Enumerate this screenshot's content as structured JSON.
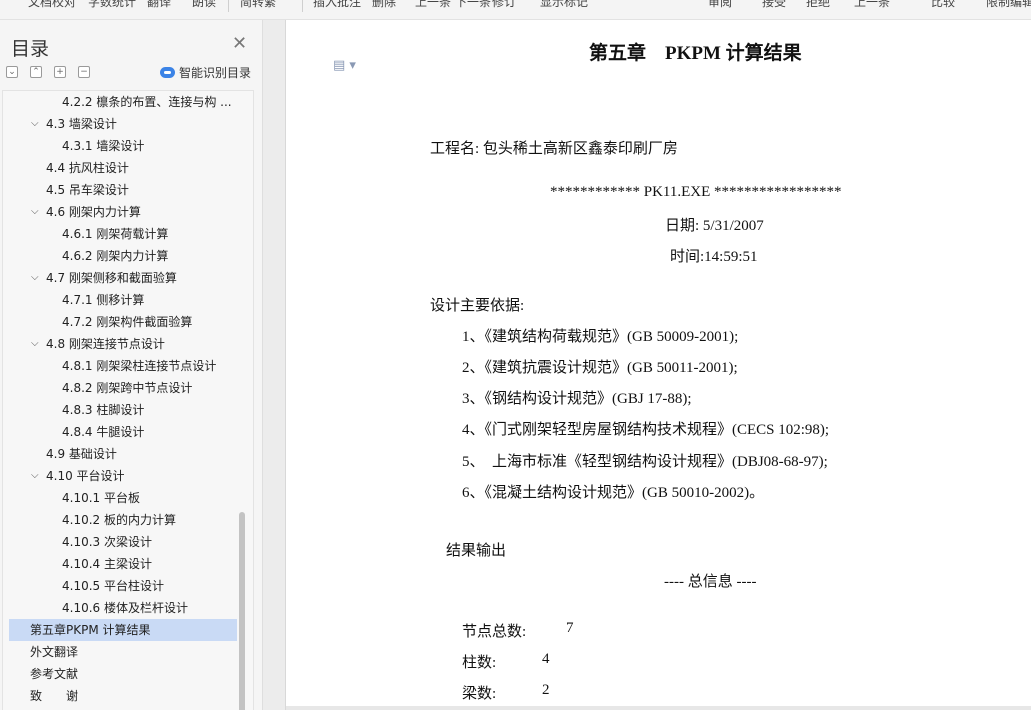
{
  "toolbar": {
    "items": [
      "文档校对",
      "字数统计",
      "翻译",
      "朗读",
      "简转繁",
      "插入批注",
      "删除",
      "上一条",
      "下一条",
      "修订",
      "显示标记",
      "审阅",
      "接受",
      "拒绝",
      "上一条",
      "比较",
      "限制编辑"
    ]
  },
  "sidebar": {
    "title": "目录",
    "smart_toc_label": "智能识别目录",
    "items": [
      {
        "text": "4.2.2 檩条的布置、连接与构 ...",
        "level": 3,
        "expandable": false
      },
      {
        "text": "4.3 墙梁设计",
        "level": 2,
        "expandable": true
      },
      {
        "text": "4.3.1 墙梁设计",
        "level": 3,
        "expandable": false
      },
      {
        "text": "4.4 抗风柱设计",
        "level": 2,
        "expandable": false
      },
      {
        "text": "4.5 吊车梁设计",
        "level": 2,
        "expandable": false
      },
      {
        "text": "4.6 刚架内力计算",
        "level": 2,
        "expandable": true
      },
      {
        "text": "4.6.1 刚架荷载计算",
        "level": 3,
        "expandable": false
      },
      {
        "text": "4.6.2 刚架内力计算",
        "level": 3,
        "expandable": false
      },
      {
        "text": "4.7 刚架侧移和截面验算",
        "level": 2,
        "expandable": true
      },
      {
        "text": "4.7.1 侧移计算",
        "level": 3,
        "expandable": false
      },
      {
        "text": "4.7.2 刚架构件截面验算",
        "level": 3,
        "expandable": false
      },
      {
        "text": "4.8 刚架连接节点设计",
        "level": 2,
        "expandable": true
      },
      {
        "text": "4.8.1 刚架梁柱连接节点设计",
        "level": 3,
        "expandable": false
      },
      {
        "text": "4.8.2 刚架跨中节点设计",
        "level": 3,
        "expandable": false
      },
      {
        "text": "4.8.3 柱脚设计",
        "level": 3,
        "expandable": false
      },
      {
        "text": "4.8.4 牛腿设计",
        "level": 3,
        "expandable": false
      },
      {
        "text": "4.9 基础设计",
        "level": 2,
        "expandable": false
      },
      {
        "text": "4.10 平台设计",
        "level": 2,
        "expandable": true
      },
      {
        "text": "4.10.1 平台板",
        "level": 3,
        "expandable": false
      },
      {
        "text": "4.10.2 板的内力计算",
        "level": 3,
        "expandable": false
      },
      {
        "text": "4.10.3 次梁设计",
        "level": 3,
        "expandable": false
      },
      {
        "text": "4.10.4 主梁设计",
        "level": 3,
        "expandable": false
      },
      {
        "text": "4.10.5 平台柱设计",
        "level": 3,
        "expandable": false
      },
      {
        "text": "4.10.6 楼体及栏杆设计",
        "level": 3,
        "expandable": false
      },
      {
        "text": "第五章PKPM 计算结果",
        "level": 1,
        "expandable": false,
        "active": true
      },
      {
        "text": "外文翻译",
        "level": 1,
        "expandable": false
      },
      {
        "text": "参考文献",
        "level": 1,
        "expandable": false
      },
      {
        "text": "致　　谢",
        "level": 1,
        "expandable": false
      }
    ]
  },
  "document": {
    "chapter_title": "第五章　PKPM 计算结果",
    "project_label": "工程名: 包头稀土高新区鑫泰印刷厂房",
    "exe_line": "************    PK11.EXE    *****************",
    "date_line": "日期: 5/31/2007",
    "time_line": "时间:14:59:51",
    "basis_heading": "设计主要依据:",
    "basis": [
      "1、《建筑结构荷载规范》(GB 50009-2001);",
      "2、《建筑抗震设计规范》(GB 50011-2001);",
      "3、《钢结构设计规范》(GBJ 17-88);",
      "4、《门式刚架轻型房屋钢结构技术规程》(CECS 102:98);",
      "5、　上海市标准《轻型钢结构设计规程》(DBJ08-68-97);",
      "6、《混凝土结构设计规范》(GB 50010-2002)。"
    ],
    "results_heading": "结果输出",
    "summary_heading": "----  总信息  ----",
    "stats": [
      {
        "label": "节点总数:",
        "value": "7"
      },
      {
        "label": "柱数:",
        "value": "4"
      },
      {
        "label": "梁数:",
        "value": "2"
      }
    ]
  },
  "colors": {
    "active_toc": "#c9daf5",
    "accent": "#3b83e6"
  }
}
